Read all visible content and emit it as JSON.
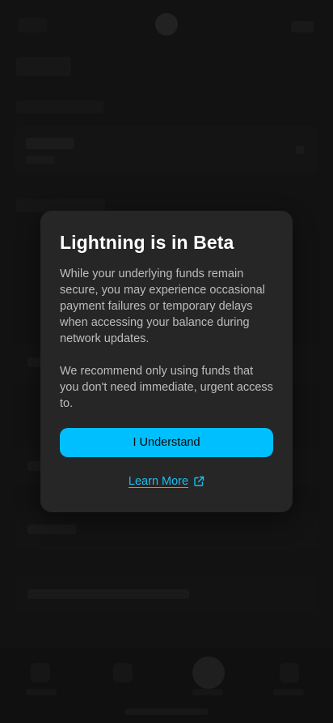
{
  "modal": {
    "title": "Lightning is in Beta",
    "paragraph_1": "While your underlying funds remain secure, you may experience occasional payment failures or temporary delays when accessing your balance during network updates.",
    "paragraph_2": "We recommend only using funds that you don't need immediate, urgent access to.",
    "primary_button_label": "I Understand",
    "learn_more_label": "Learn More",
    "learn_more_icon": "external-link-icon"
  },
  "colors": {
    "accent": "#00BFFF",
    "link": "#16C0F5",
    "modal_background": "#262626",
    "screen_background": "#161616"
  }
}
